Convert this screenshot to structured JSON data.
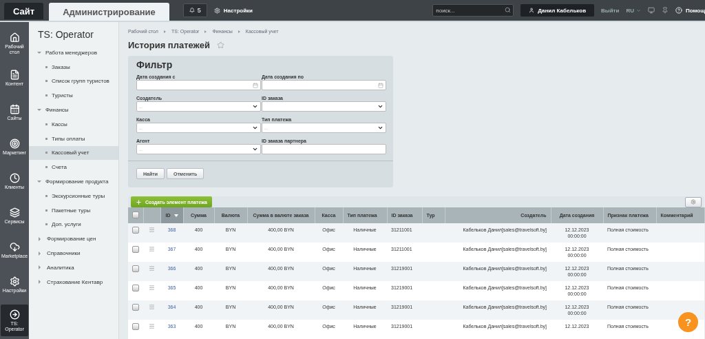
{
  "top_bar": {
    "tabs": [
      {
        "label": "Сайт",
        "selected": false
      },
      {
        "label": "Администрирование",
        "selected": true
      }
    ],
    "notifications": "5",
    "settings": "Настройки",
    "search": {
      "placeholder": "поиск..."
    },
    "user": "Данил Кабельков",
    "logout": "Выйти",
    "language": "RU",
    "help": "Помощ"
  },
  "rail": [
    {
      "label": "Рабочий стол",
      "kind": "home",
      "selected": false
    },
    {
      "label": "Контент",
      "kind": "content",
      "selected": false
    },
    {
      "label": "Сайты",
      "kind": "sites",
      "selected": false
    },
    {
      "label": "Маркетинг",
      "kind": "marketing",
      "selected": false
    },
    {
      "label": "Клиенты",
      "kind": "clients",
      "selected": false
    },
    {
      "label": "Сервисы",
      "kind": "services",
      "selected": false
    },
    {
      "label": "Marketplace",
      "kind": "marketplace",
      "selected": false
    },
    {
      "label": "Настройки",
      "kind": "settings",
      "selected": false
    },
    {
      "label": "TS: Operator",
      "kind": "operator",
      "selected": true
    }
  ],
  "sidebar": {
    "title": "TS: Operator",
    "items": [
      {
        "label": "Работа менеджеров",
        "expanded": true,
        "children": [
          {
            "label": "Заказы",
            "selected": false
          },
          {
            "label": "Список групп туристов",
            "selected": false
          },
          {
            "label": "Туристы",
            "selected": false
          }
        ]
      },
      {
        "label": "Финансы",
        "expanded": true,
        "children": [
          {
            "label": "Кассы",
            "selected": false
          },
          {
            "label": "Типы оплаты",
            "selected": false
          },
          {
            "label": "Кассовый учет",
            "selected": true
          },
          {
            "label": "Счета",
            "selected": false
          }
        ]
      },
      {
        "label": "Формирование продукта",
        "expanded": true,
        "children": [
          {
            "label": "Экскурсионные туры",
            "selected": false
          },
          {
            "label": "Пакетные туры",
            "selected": false
          },
          {
            "label": "Доп. услуги",
            "selected": false
          }
        ]
      },
      {
        "label": "Формирование цен",
        "expanded": false
      },
      {
        "label": "Справочники",
        "expanded": false
      },
      {
        "label": "Аналитика",
        "expanded": false
      },
      {
        "label": "Страхование Кентавр",
        "expanded": false
      }
    ]
  },
  "breadcrumbs": [
    "Рабочий стол",
    "TS: Operator",
    "Финансы",
    "Кассовый учет"
  ],
  "page": {
    "title": "История платежей",
    "favorite": false
  },
  "filter": {
    "title": "Фильтр",
    "fields": [
      {
        "label": "Дата создания с",
        "kind": "date"
      },
      {
        "label": "Дата создания по",
        "kind": "date"
      },
      {
        "label": "Создатель",
        "kind": "select",
        "value": "..."
      },
      {
        "label": "ID заказа",
        "kind": "select"
      },
      {
        "label": "Касса",
        "kind": "select",
        "value": "..."
      },
      {
        "label": "Тип платежа",
        "kind": "select",
        "value": "..."
      },
      {
        "label": "Агент",
        "kind": "select",
        "value": "..."
      },
      {
        "label": "ID заказа партнера",
        "kind": "text"
      }
    ],
    "buttons": [
      "Найти",
      "Отменить"
    ]
  },
  "grid": {
    "create_button": "Создать элемент платежа",
    "select_all": false,
    "columns": [
      {
        "label": "ID",
        "sorted": true
      },
      {
        "label": "Сумма",
        "sorted": false
      },
      {
        "label": "Валюта",
        "sorted": false
      },
      {
        "label": "Сумма в валюте заказа",
        "sorted": false
      },
      {
        "label": "Касса",
        "sorted": false
      },
      {
        "label": "Тип платежа",
        "sorted": false
      },
      {
        "label": "ID заказа",
        "sorted": false
      },
      {
        "label": "Тур",
        "sorted": false
      },
      {
        "label": "Создатель",
        "sorted": false
      },
      {
        "label": "Дата создания",
        "sorted": false
      },
      {
        "label": "Признак платежа",
        "sorted": false
      },
      {
        "label": "Комментарий",
        "sorted": false
      }
    ],
    "rows": [
      {
        "checked": false,
        "cells": [
          "368",
          "400",
          "BYN",
          "400,00 BYN",
          "Офис",
          "Наличные",
          "31211001",
          null,
          "Кабельков Данил[sales@travelsoft.by]",
          "12.12.2023 00:00:00",
          "Полная стоимость",
          null
        ]
      },
      {
        "checked": false,
        "cells": [
          "367",
          "400",
          "BYN",
          "400,00 BYN",
          "Офис",
          "Наличные",
          "31211001",
          null,
          "Кабельков Данил[sales@travelsoft.by]",
          "12.12.2023 00:00:00",
          "Полная стоимость",
          null
        ]
      },
      {
        "checked": false,
        "cells": [
          "366",
          "400",
          "BYN",
          "400,00 BYN",
          "Офис",
          "Наличные",
          "31219001",
          null,
          "Кабельков Данил[sales@travelsoft.by]",
          "12.12.2023 00:00:00",
          "Полная стоимость",
          null
        ]
      },
      {
        "checked": false,
        "cells": [
          "365",
          "400",
          "BYN",
          "400,00 BYN",
          "Офис",
          "Наличные",
          "31219001",
          null,
          "Кабельков Данил[sales@travelsoft.by]",
          "12.12.2023 00:00:00",
          "Полная стоимость",
          null
        ]
      },
      {
        "checked": false,
        "cells": [
          "364",
          "400",
          "BYN",
          "400,00 BYN",
          "Офис",
          "Наличные",
          "31219001",
          null,
          "Кабельков Данил[sales@travelsoft.by]",
          "12.12.2023 00:00:00",
          "Полная стоимость",
          null
        ]
      },
      {
        "checked": false,
        "cells": [
          "363",
          "400",
          "BYN",
          "400,00 BYN",
          "Офис",
          "Наличные",
          "31219001",
          null,
          "Кабельков Данил[sales@travelsoft.by]",
          "12.12.2023",
          "Полная стоимость",
          null
        ]
      }
    ]
  },
  "help_button": "?"
}
